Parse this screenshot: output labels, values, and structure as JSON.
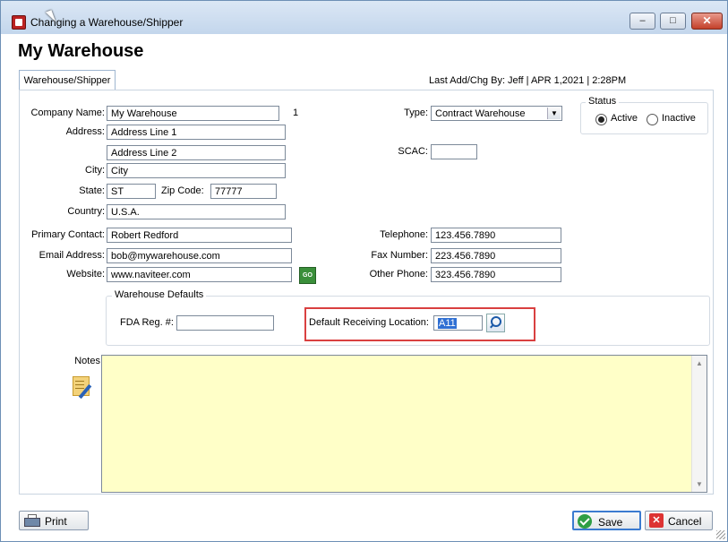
{
  "window": {
    "title": "Changing a Warehouse/Shipper",
    "controls": {
      "minimize": "–",
      "maximize": "□",
      "close": "✕"
    }
  },
  "header": {
    "big_title": "My Warehouse",
    "tab_label": "Warehouse/Shipper",
    "last_change": "Last Add/Chg By: Jeff | APR  1,2021 |  2:28PM"
  },
  "form": {
    "company_name_label": "Company Name:",
    "company_name": "My Warehouse",
    "company_count": "1",
    "address_label": "Address:",
    "address1": "Address Line 1",
    "address2": "Address Line 2",
    "city_label": "City:",
    "city": "City",
    "state_label": "State:",
    "state": "ST",
    "zip_label": "Zip Code:",
    "zip": "77777",
    "country_label": "Country:",
    "country": "U.S.A.",
    "type_label": "Type:",
    "type_value": "Contract Warehouse",
    "scac_label": "SCAC:",
    "scac": "",
    "status_title": "Status",
    "status_active": "Active",
    "status_inactive": "Inactive",
    "primary_contact_label": "Primary Contact:",
    "primary_contact": "Robert Redford",
    "email_label": "Email Address:",
    "email": "bob@mywarehouse.com",
    "website_label": "Website:",
    "website": "www.naviteer.com",
    "go_label": "GO",
    "telephone_label": "Telephone:",
    "telephone": "123.456.7890",
    "fax_label": "Fax Number:",
    "fax": "223.456.7890",
    "other_phone_label": "Other Phone:",
    "other_phone": "323.456.7890"
  },
  "defaults": {
    "title": "Warehouse Defaults",
    "fda_label": "FDA Reg. #:",
    "fda": "",
    "receiving_label": "Default Receiving Location:",
    "receiving_value": "A11"
  },
  "notes": {
    "label": "Notes:",
    "value": ""
  },
  "footer": {
    "print_label": "Print",
    "save_label": "Save",
    "cancel_label": "Cancel"
  },
  "colors": {
    "notes_background": "#ffffc8",
    "highlight_border": "#d94040",
    "selection": "#2f6fd3"
  }
}
